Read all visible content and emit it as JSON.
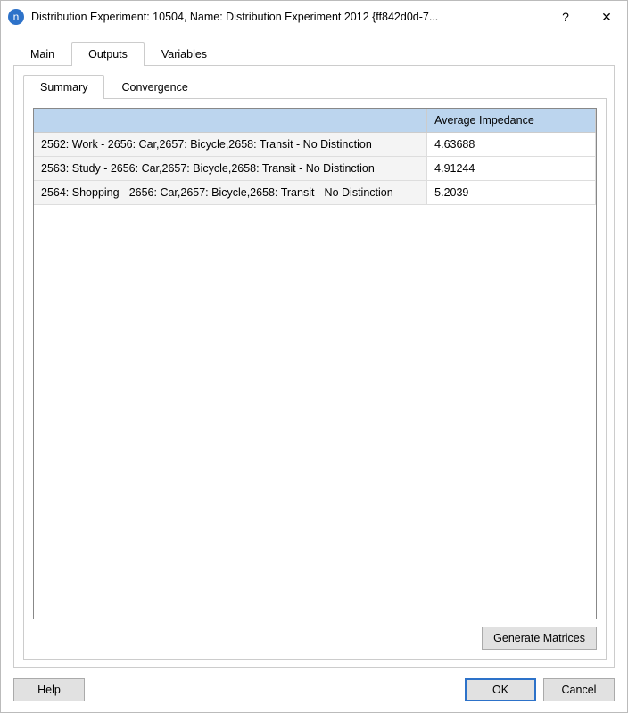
{
  "titlebar": {
    "title": "Distribution Experiment: 10504, Name: Distribution Experiment 2012  {ff842d0d-7...",
    "appicon_letter": "n",
    "help_glyph": "?",
    "close_glyph": "✕"
  },
  "tabs1": {
    "main": "Main",
    "outputs": "Outputs",
    "variables": "Variables"
  },
  "tabs2": {
    "summary": "Summary",
    "convergence": "Convergence"
  },
  "table": {
    "hdr_empty": "",
    "hdr_avg": "Average Impedance",
    "rows": [
      {
        "desc": "2562: Work - 2656: Car,2657: Bicycle,2658: Transit - No Distinction",
        "val": "4.63688"
      },
      {
        "desc": "2563: Study - 2656: Car,2657: Bicycle,2658: Transit - No Distinction",
        "val": "4.91244"
      },
      {
        "desc": "2564: Shopping - 2656: Car,2657: Bicycle,2658: Transit - No Distinction",
        "val": "5.2039"
      }
    ]
  },
  "buttons": {
    "generate": "Generate Matrices",
    "help": "Help",
    "ok": "OK",
    "cancel": "Cancel"
  }
}
